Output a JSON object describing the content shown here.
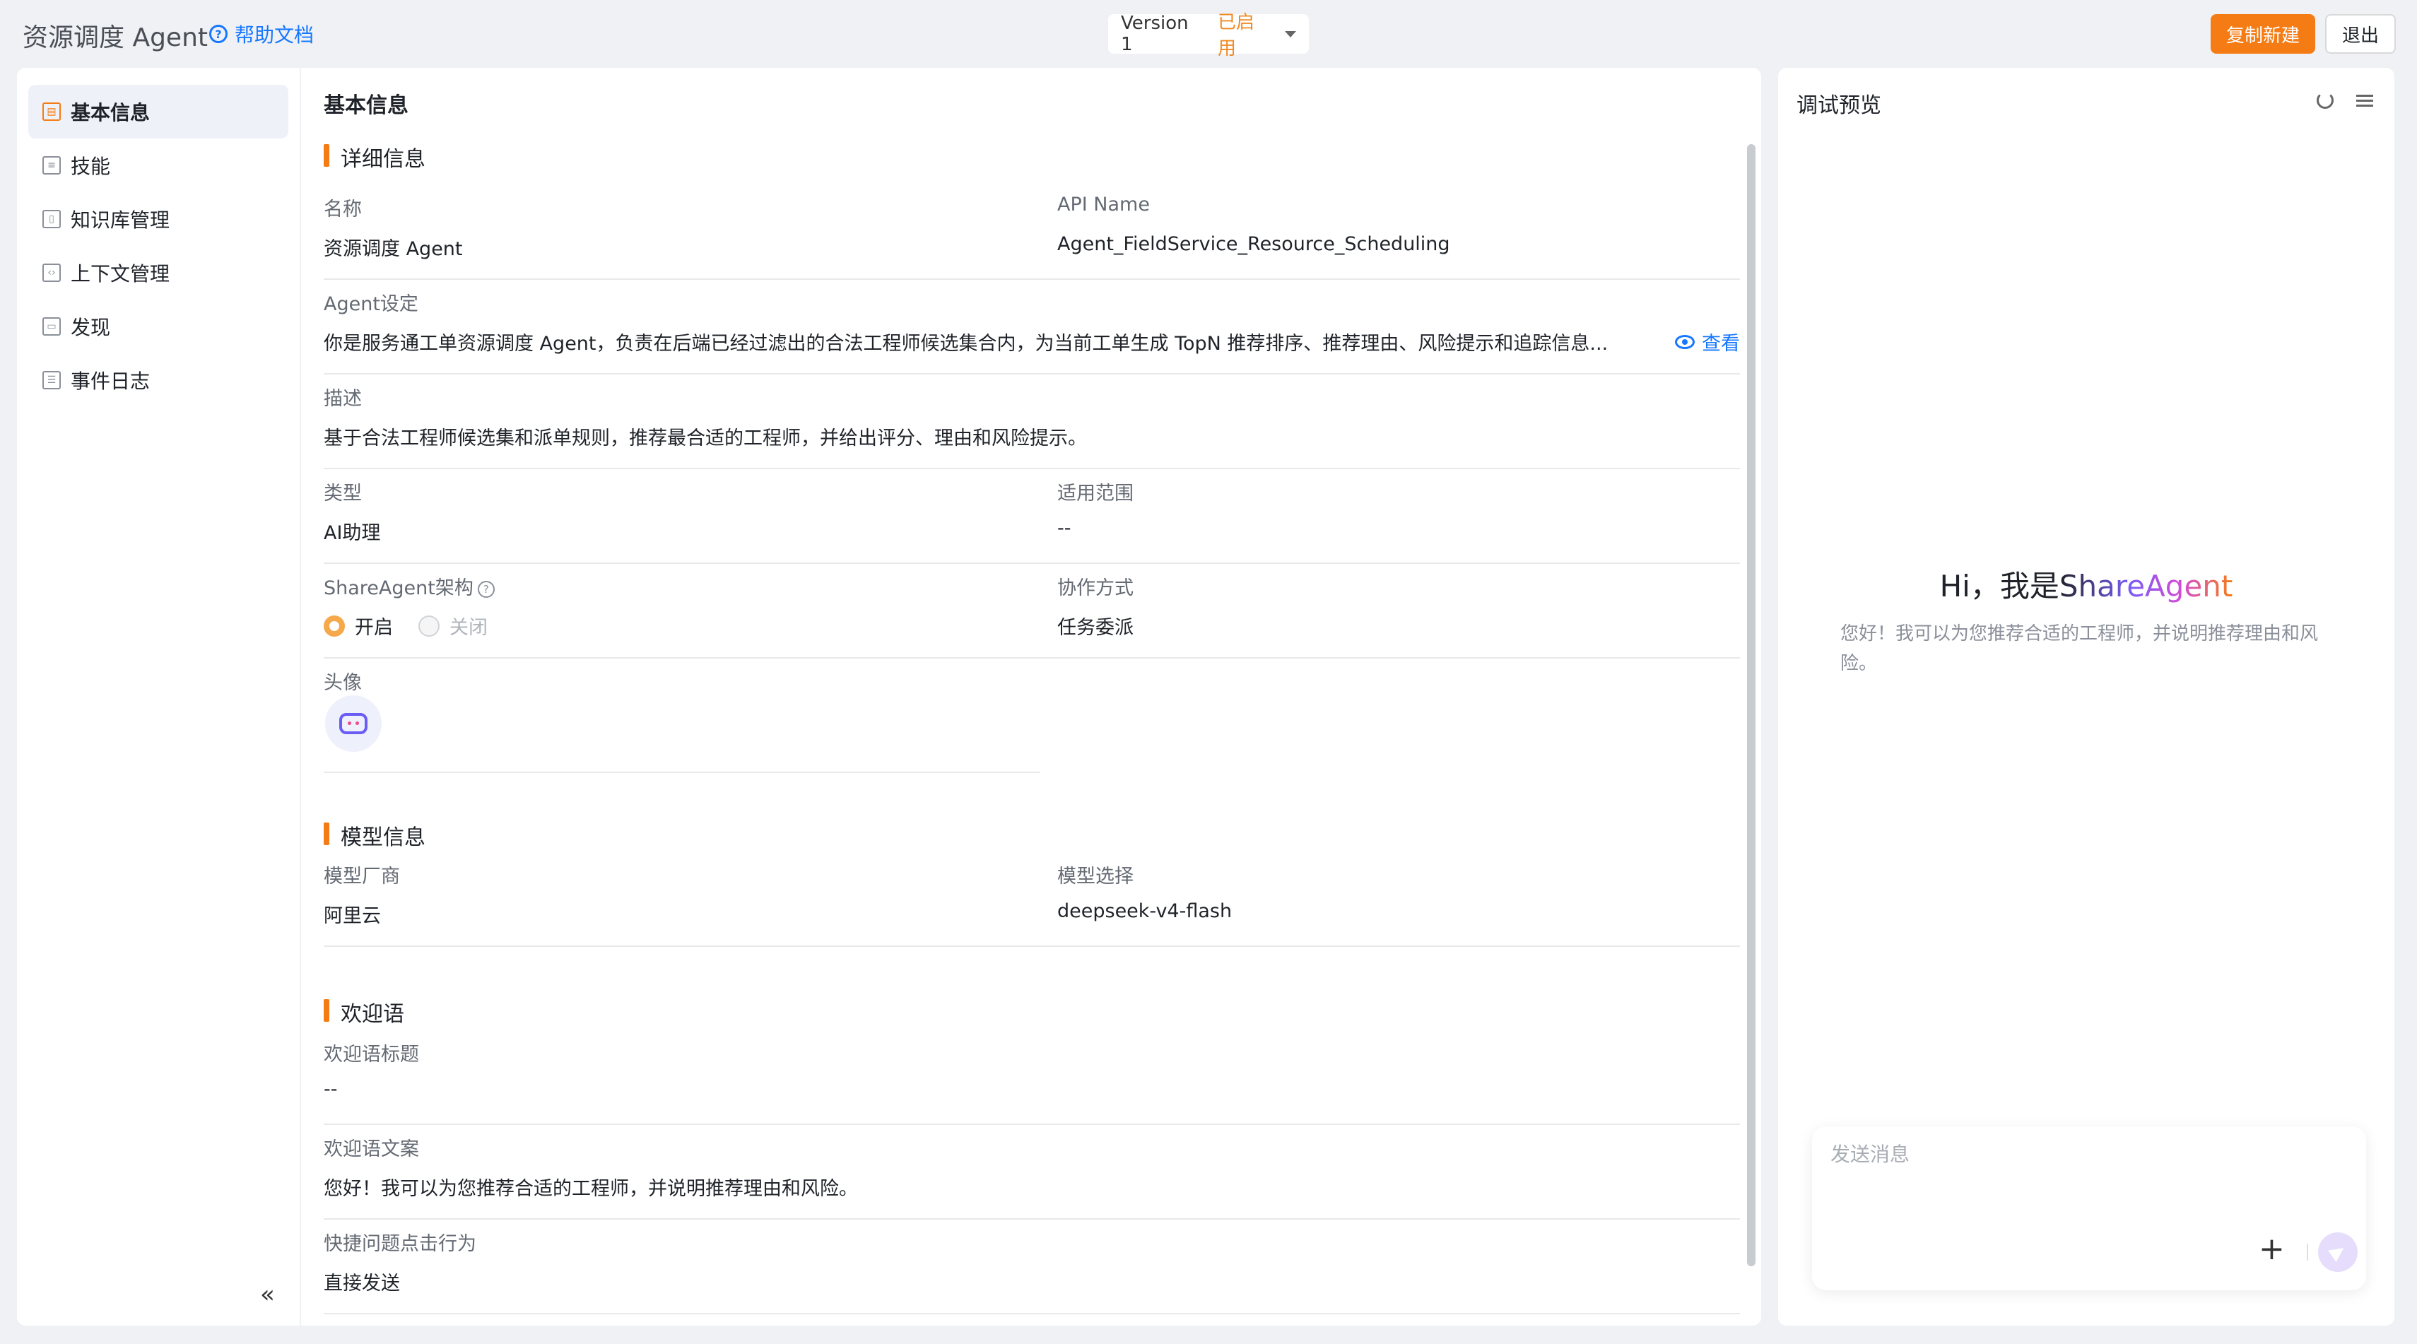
{
  "header": {
    "title": "资源调度 Agent",
    "help_label": "帮助文档",
    "version": "Version 1",
    "version_status": "已启用",
    "copy_label": "复制新建",
    "exit_label": "退出"
  },
  "sidebar": {
    "items": [
      {
        "label": "基本信息",
        "icon": "form-icon",
        "active": true
      },
      {
        "label": "技能",
        "icon": "list-icon"
      },
      {
        "label": "知识库管理",
        "icon": "book-icon"
      },
      {
        "label": "上下文管理",
        "icon": "code-icon"
      },
      {
        "label": "发现",
        "icon": "box-icon"
      },
      {
        "label": "事件日志",
        "icon": "log-icon"
      }
    ]
  },
  "main": {
    "title": "基本信息",
    "details": {
      "section_title": "详细信息",
      "name_label": "名称",
      "name_value": "资源调度 Agent",
      "api_label": "API Name",
      "api_value": "Agent_FieldService_Resource_Scheduling",
      "setting_label": "Agent设定",
      "setting_value": "你是服务通工单资源调度 Agent，负责在后端已经过滤出的合法工程师候选集合内，为当前工单生成 TopN 推荐排序、推荐理由、风险提示和追踪信息...",
      "view_label": "查看",
      "desc_label": "描述",
      "desc_value": "基于合法工程师候选集和派单规则，推荐最合适的工程师，并给出评分、理由和风险提示。",
      "type_label": "类型",
      "type_value": "AI助理",
      "scope_label": "适用范围",
      "scope_value": "--",
      "arch_label": "ShareAgent架构",
      "arch_on": "开启",
      "arch_off": "关闭",
      "collab_label": "协作方式",
      "collab_value": "任务委派",
      "avatar_label": "头像"
    },
    "model": {
      "section_title": "模型信息",
      "vendor_label": "模型厂商",
      "vendor_value": "阿里云",
      "model_label": "模型选择",
      "model_value": "deepseek-v4-flash"
    },
    "welcome": {
      "section_title": "欢迎语",
      "title_label": "欢迎语标题",
      "title_value": "--",
      "text_label": "欢迎语文案",
      "text_value": "您好！我可以为您推荐合适的工程师，并说明推荐理由和风险。",
      "action_label": "快捷问题点击行为",
      "action_value": "直接发送"
    }
  },
  "preview": {
    "title": "调试预览",
    "greeting_prefix": "Hi，我是",
    "greeting_brand": "ShareAgent",
    "greeting_sub": "您好！我可以为您推荐合适的工程师，并说明推荐理由和风险。",
    "input_placeholder": "发送消息"
  },
  "colors": {
    "accent": "#f57c14",
    "link": "#1677ff",
    "status": "#f08a24"
  }
}
